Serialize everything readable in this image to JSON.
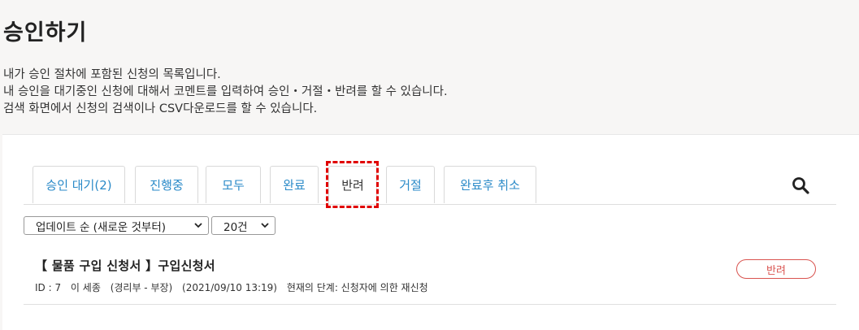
{
  "page": {
    "title": "승인하기",
    "description": [
      "내가 승인 절차에 포함된 신청의 목록입니다.",
      "내 승인을 대기중인 신청에 대해서 코멘트를 입력하여 승인・거절・반려를 할 수 있습니다.",
      "검색 화면에서 신청의 검색이나 CSV다운로드를 할 수 있습니다."
    ]
  },
  "tabs": [
    {
      "label": "승인 대기(2)"
    },
    {
      "label": "진행중"
    },
    {
      "label": "모두"
    },
    {
      "label": "완료"
    },
    {
      "label": "반려",
      "active": true
    },
    {
      "label": "거절"
    },
    {
      "label": "완료후 취소"
    }
  ],
  "filters": {
    "sort": "업데이트 순 (새로운 것부터)",
    "count": "20건"
  },
  "items": [
    {
      "title": "【 물품 구입 신청서 】구입신청서",
      "id": "ID : 7",
      "user": "이 세종",
      "dept": "(경리부 - 부장)",
      "datetime": "(2021/09/10 13:19)",
      "stage": "현재의 단계: 신청자에 의한 재신청",
      "status": "반려"
    }
  ],
  "icons": {
    "search": "search-icon",
    "dropdown": "chevron-down-icon"
  },
  "colors": {
    "tab_text": "#2a8ac8",
    "status_border": "#d9534f",
    "highlight": "#e00000"
  }
}
